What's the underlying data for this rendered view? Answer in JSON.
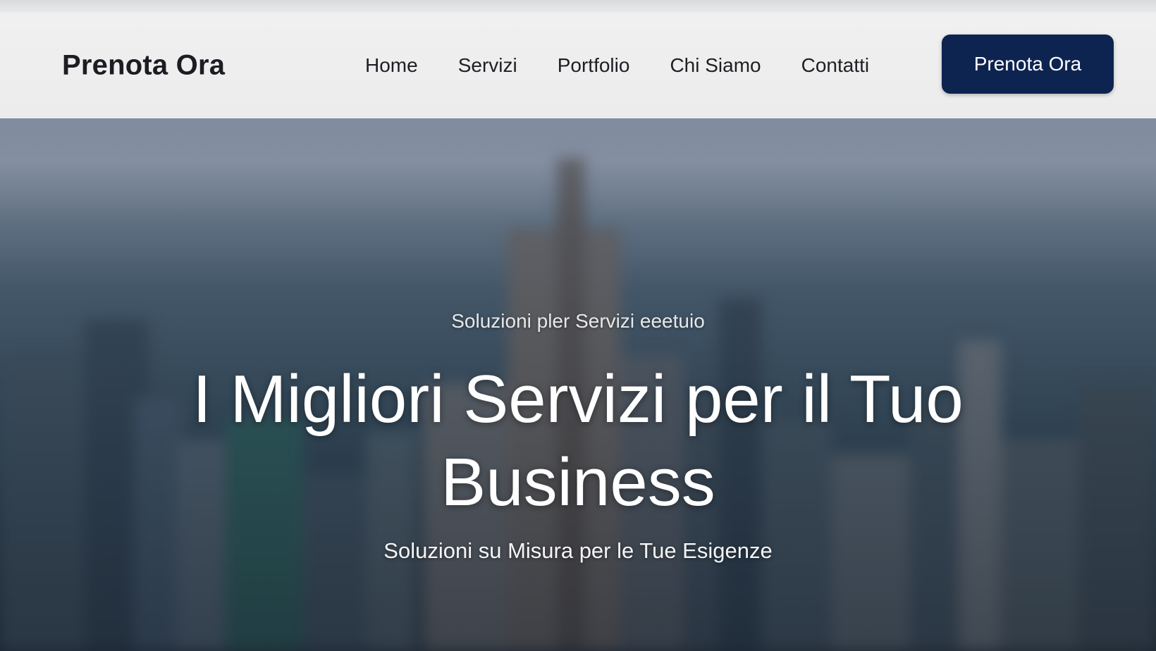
{
  "navbar": {
    "brand": "Prenota Ora",
    "links": [
      {
        "label": "Home"
      },
      {
        "label": "Servizi"
      },
      {
        "label": "Portfolio"
      },
      {
        "label": "Chi Siamo"
      },
      {
        "label": "Contatti"
      }
    ],
    "cta_label": "Prenota Ora"
  },
  "hero": {
    "eyebrow": "Soluzioni pler Servizi eeetuio",
    "headline": "I Migliori Servizi per il Tuo Business",
    "subhead": "Soluzioni su Misura per le Tue Esigenze"
  },
  "colors": {
    "cta_bg": "#0e2450",
    "navbar_bg": "#eeeeee",
    "text_dark": "#1b1d22"
  }
}
